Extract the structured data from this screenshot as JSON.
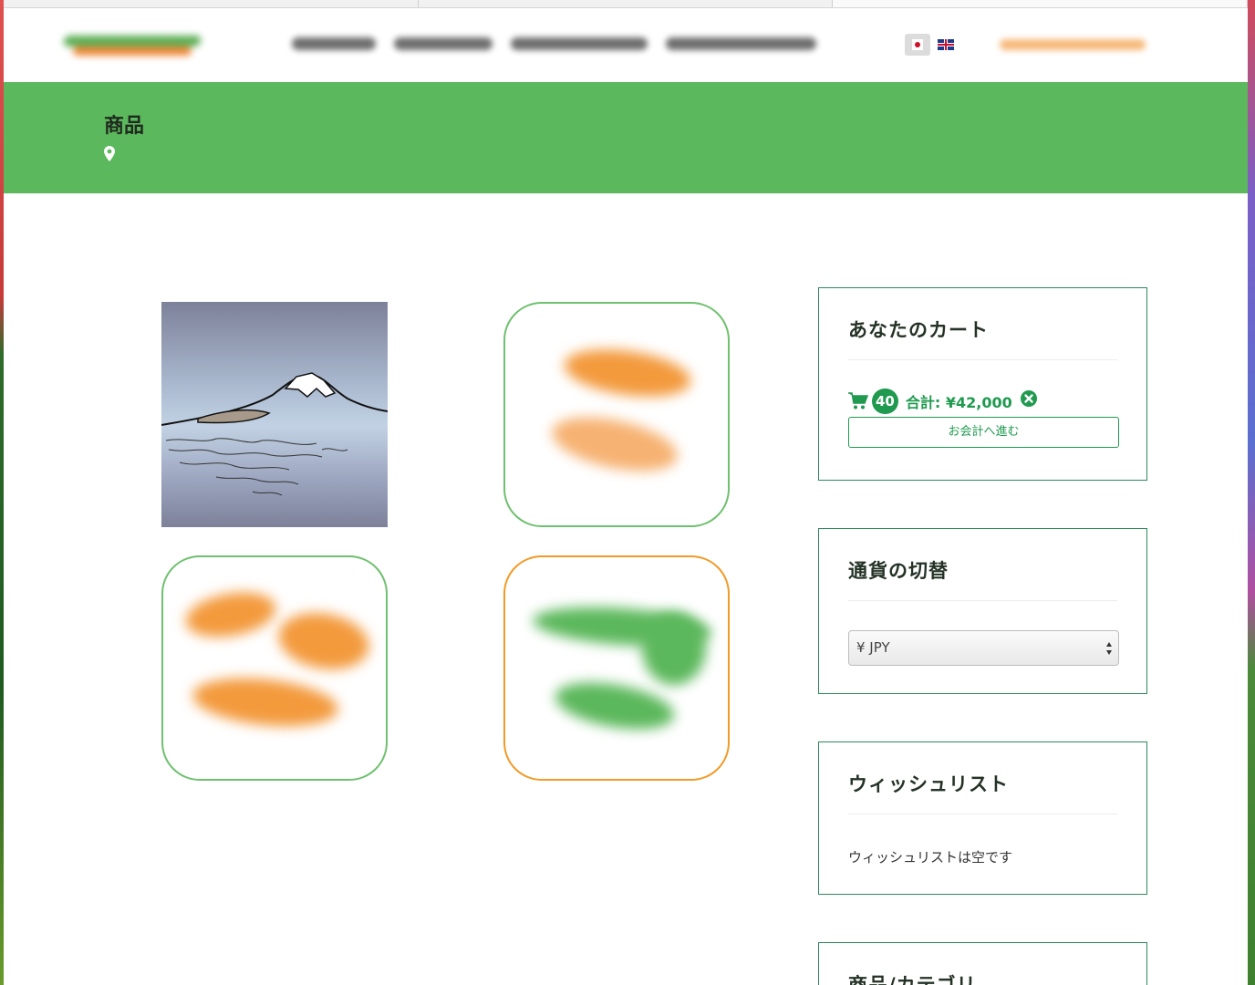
{
  "header": {
    "languages": [
      {
        "code": "ja",
        "icon": "japan-flag-icon"
      },
      {
        "code": "en",
        "icon": "uk-flag-icon"
      }
    ]
  },
  "banner": {
    "title": "商品",
    "icon": "map-pin-icon",
    "color": "#5cb85c"
  },
  "products": [
    {
      "image": "mount-fuji-illustration"
    },
    {
      "image": "placeholder-orange"
    },
    {
      "image": "placeholder-orange"
    },
    {
      "image": "placeholder-green"
    }
  ],
  "cart": {
    "title": "あなたのカート",
    "count": "40",
    "total": "合計: ¥42,000",
    "checkout_label": "お会計へ進む",
    "accent": "#1f9a4f"
  },
  "currency": {
    "title": "通貨の切替",
    "selected": "¥ JPY"
  },
  "wishlist": {
    "title": "ウィッシュリスト",
    "empty_text": "ウィッシュリストは空です"
  },
  "categories": {
    "title": "商品/カテゴリ"
  }
}
